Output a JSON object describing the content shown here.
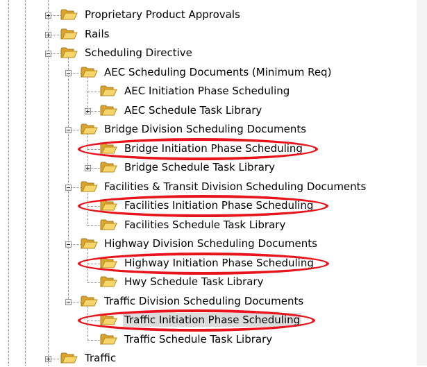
{
  "tree": {
    "nodes": [
      {
        "label": "Proprietary Product Approvals",
        "expander": "plus",
        "level": 0
      },
      {
        "label": "Rails",
        "expander": "plus",
        "level": 0
      },
      {
        "label": "Scheduling Directive",
        "expander": "minus",
        "level": 0
      },
      {
        "label": "AEC Scheduling Documents (Minimum Req)",
        "expander": "minus",
        "level": 1
      },
      {
        "label": "AEC Initiation Phase Scheduling",
        "expander": "none",
        "level": 2
      },
      {
        "label": "AEC Schedule Task Library",
        "expander": "plus",
        "level": 2
      },
      {
        "label": "Bridge Division Scheduling Documents",
        "expander": "minus",
        "level": 1
      },
      {
        "label": "Bridge Initiation Phase Scheduling",
        "expander": "none",
        "level": 2,
        "circled": true
      },
      {
        "label": "Bridge Schedule Task Library",
        "expander": "plus",
        "level": 2
      },
      {
        "label": "Facilities & Transit Division Scheduling Documents",
        "expander": "minus",
        "level": 1
      },
      {
        "label": "Facilities Initiation Phase Scheduling",
        "expander": "none",
        "level": 2,
        "circled": true
      },
      {
        "label": "Facilities Schedule Task Library",
        "expander": "none",
        "level": 2
      },
      {
        "label": "Highway Division Scheduling Documents",
        "expander": "minus",
        "level": 1
      },
      {
        "label": "Highway Initiation Phase Scheduling",
        "expander": "none",
        "level": 2,
        "circled": true
      },
      {
        "label": "Hwy Schedule Task Library",
        "expander": "none",
        "level": 2
      },
      {
        "label": "Traffic Division Scheduling Documents",
        "expander": "minus",
        "level": 1
      },
      {
        "label": "Traffic Initiation Phase Scheduling",
        "expander": "none",
        "level": 2,
        "circled": true,
        "selected": true
      },
      {
        "label": "Traffic Schedule Task Library",
        "expander": "none",
        "level": 2
      },
      {
        "label": "Traffic",
        "expander": "plus",
        "level": 0
      }
    ],
    "selected_label": "Traffic Initiation Phase Scheduling",
    "annotation_color": "#e8141c",
    "selection_color": "#dcdcdc"
  }
}
